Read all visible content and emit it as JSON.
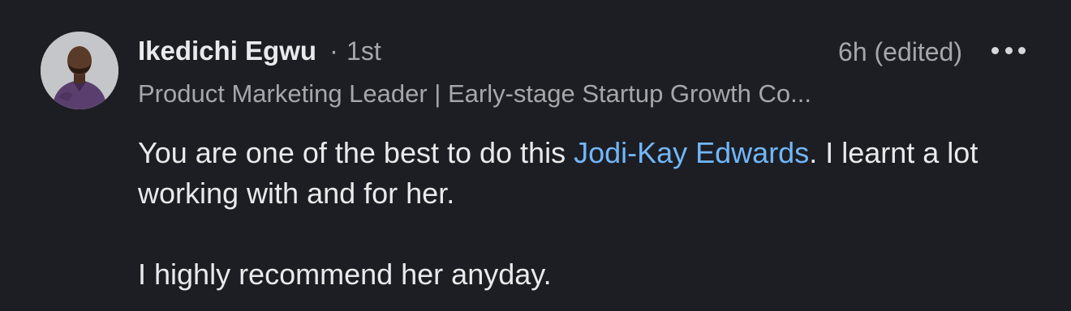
{
  "comment": {
    "author": {
      "name": "Ikedichi Egwu",
      "separator": "·",
      "connection_degree": "1st",
      "headline": "Product Marketing Leader | Early-stage Startup Growth Co..."
    },
    "timestamp": "6h (edited)",
    "more_icon": "ellipsis-horizontal-icon",
    "body": {
      "line1_before": "You are one of the best to do this ",
      "mention": "Jodi-Kay Edwards",
      "line1_after": ". I learnt a lot working with and for her.",
      "paragraph2": "I highly recommend her anyday."
    }
  },
  "colors": {
    "background": "#1d1e23",
    "primary_text": "#e9eaec",
    "secondary_text": "#a5a7ab",
    "mention_link": "#71b7fb"
  }
}
